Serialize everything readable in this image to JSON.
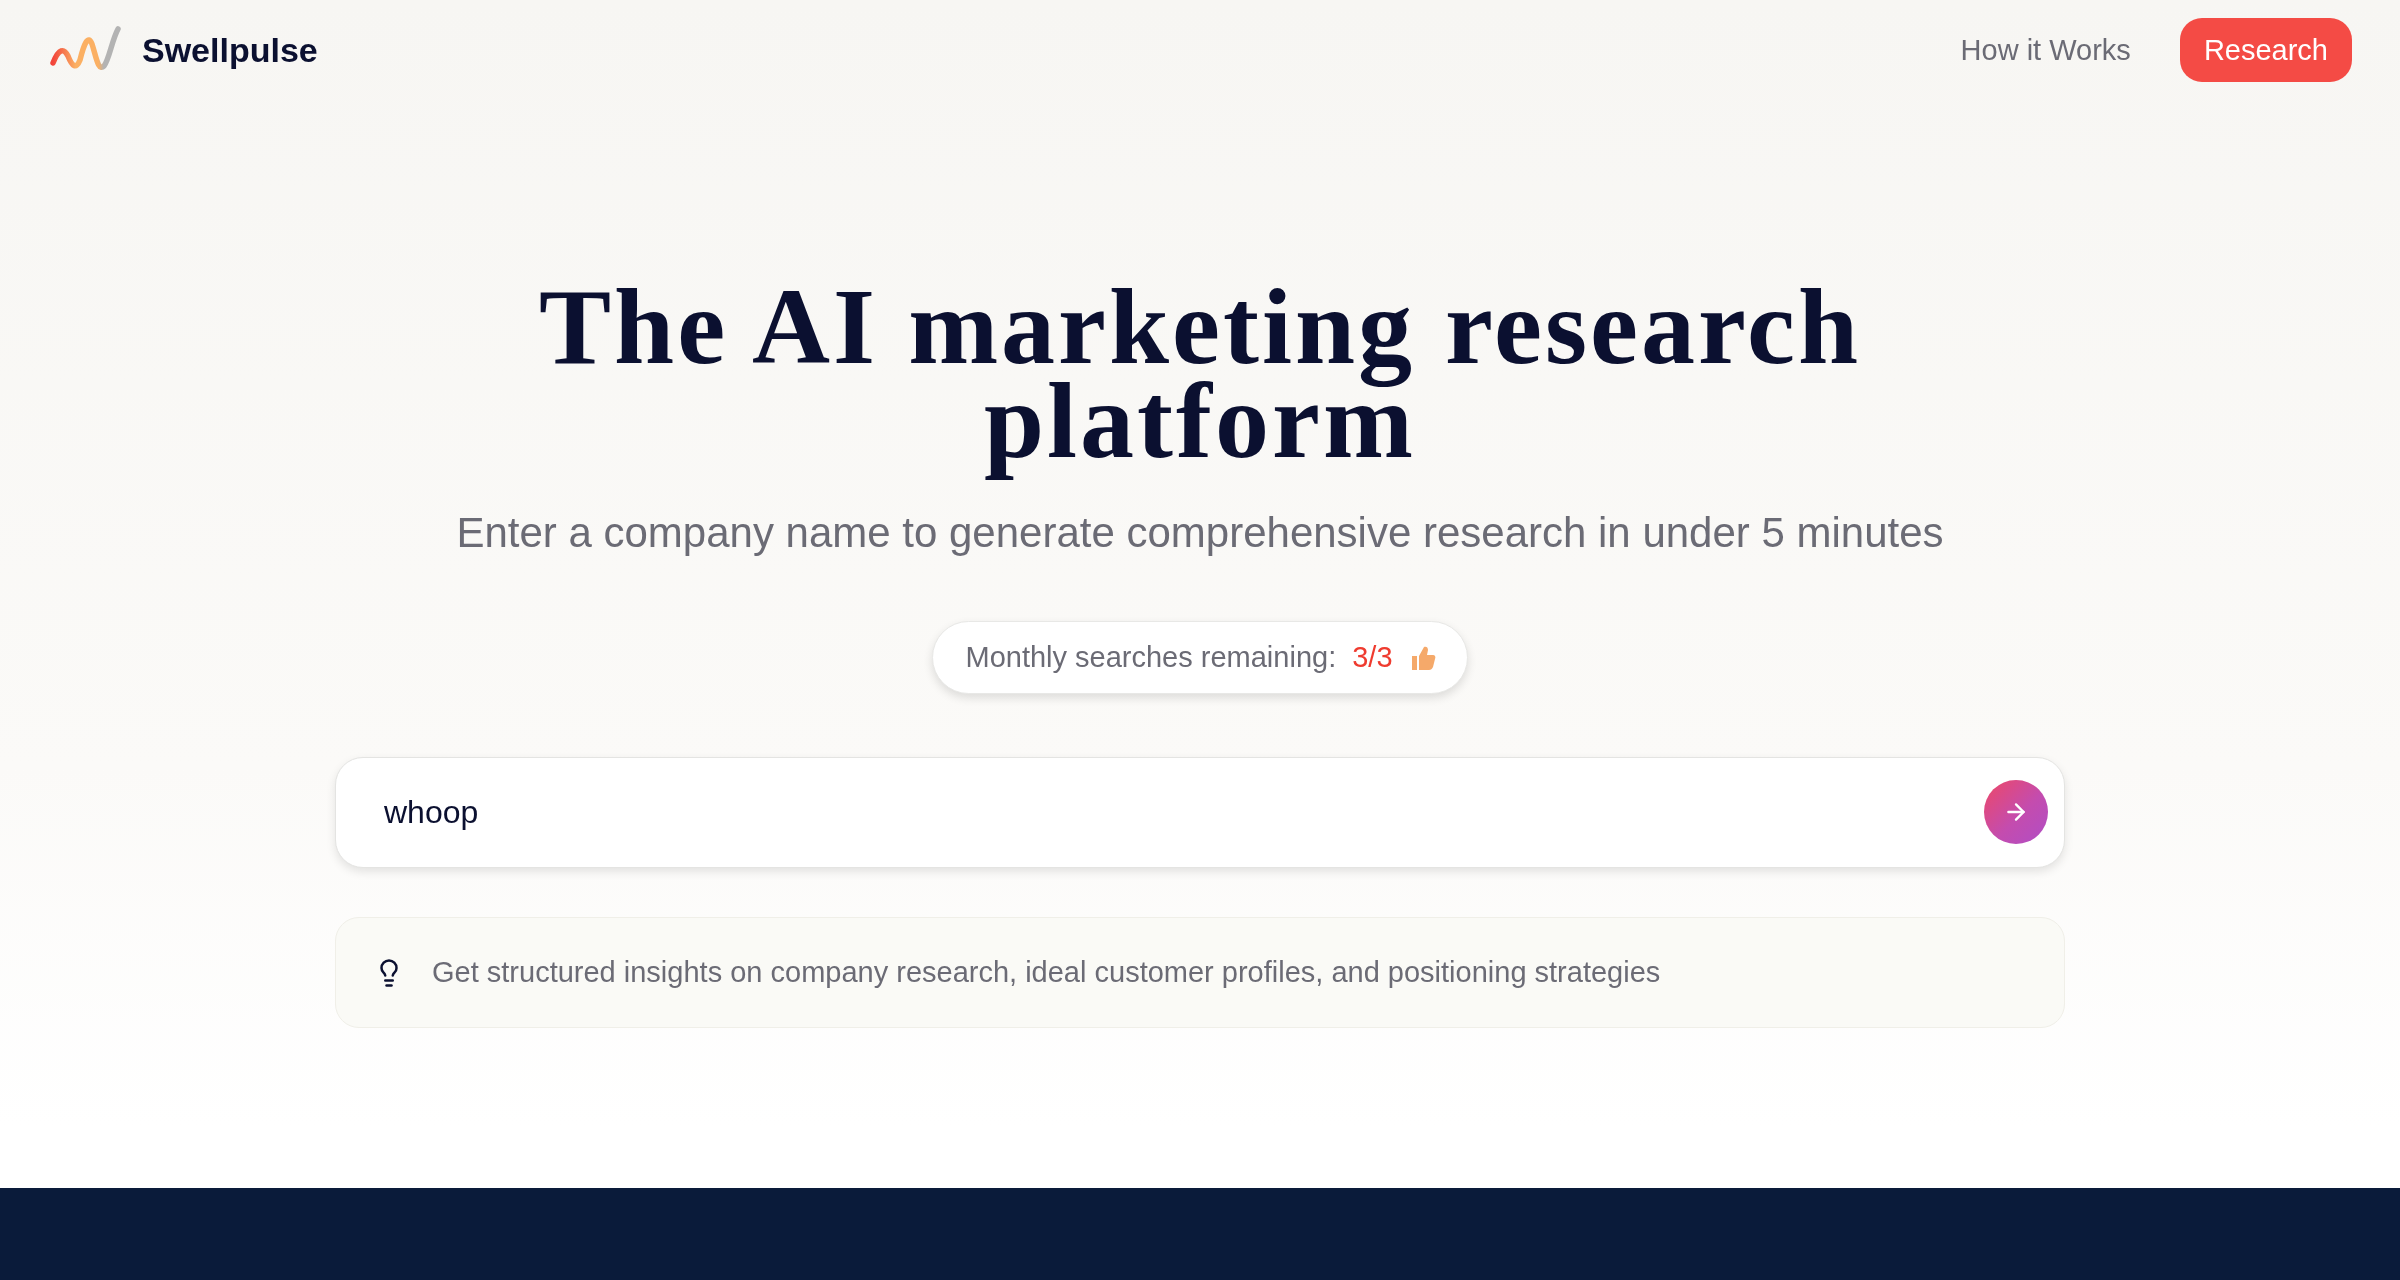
{
  "header": {
    "brand": "Swellpulse",
    "nav": [
      {
        "label": "How it Works",
        "kind": "link"
      },
      {
        "label": "Research",
        "kind": "button"
      }
    ]
  },
  "hero": {
    "title": "The AI marketing research platform",
    "subtitle": "Enter a company name to generate comprehensive research in under 5 minutes",
    "quota": {
      "label": "Monthly searches remaining:",
      "count": "3/3"
    }
  },
  "search": {
    "value": "whoop"
  },
  "tip": {
    "text": "Get structured insights on company research, ideal customer profiles, and positioning strategies"
  }
}
